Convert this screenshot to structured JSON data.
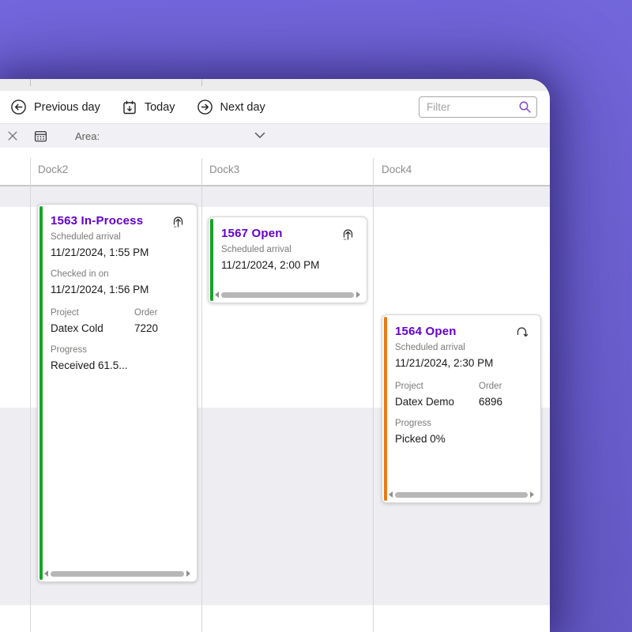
{
  "toolbar": {
    "previous_day": "Previous day",
    "today": "Today",
    "next_day": "Next day",
    "filter_placeholder": "Filter"
  },
  "area_bar": {
    "label": "Area:"
  },
  "columns": [
    {
      "label": "Dock2"
    },
    {
      "label": "Dock3"
    },
    {
      "label": "Dock4"
    }
  ],
  "cards": [
    {
      "title": "1563 In-Process",
      "status_color": "#16a426",
      "icon": "inbound-dock-icon",
      "scheduled_label": "Scheduled arrival",
      "scheduled_value": "11/21/2024, 1:55 PM",
      "checked_label": "Checked in on",
      "checked_value": "11/21/2024, 1:56 PM",
      "project_label": "Project",
      "project_value": "Datex Cold",
      "order_label": "Order",
      "order_value": "7220",
      "progress_label": "Progress",
      "progress_value": "Received 61.5..."
    },
    {
      "title": "1567 Open",
      "status_color": "#16a426",
      "icon": "inbound-dock-icon",
      "scheduled_label": "Scheduled arrival",
      "scheduled_value": "11/21/2024, 2:00 PM"
    },
    {
      "title": "1564 Open",
      "status_color": "#e97b17",
      "icon": "outbound-dock-icon",
      "scheduled_label": "Scheduled arrival",
      "scheduled_value": "11/21/2024, 2:30 PM",
      "project_label": "Project",
      "project_value": "Datex Demo",
      "order_label": "Order",
      "order_value": "6896",
      "progress_label": "Progress",
      "progress_value": "Picked 0%"
    }
  ],
  "colors": {
    "desktop_purple": "#7064d7",
    "card_title_purple": "#6300cd",
    "status_green": "#16a426",
    "status_orange": "#e97b17",
    "search_icon_purple": "#7d3fd8"
  }
}
